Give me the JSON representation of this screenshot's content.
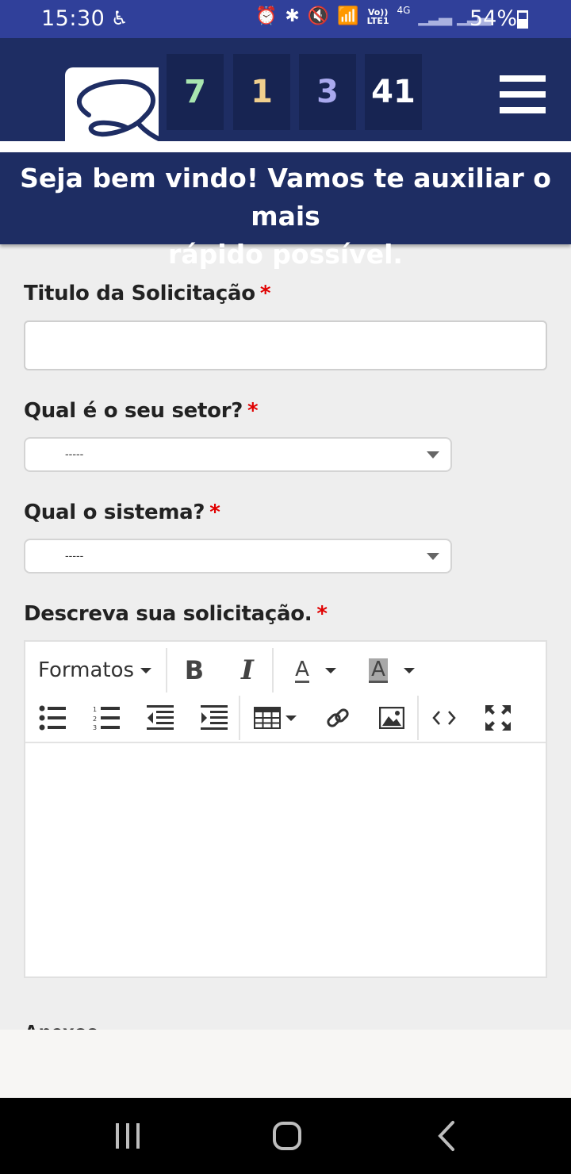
{
  "status_bar": {
    "time": "15:30",
    "battery": "54%",
    "battery_level": 0.54,
    "network_volte": "Vo))",
    "network_lte": "LTE1",
    "network_4g": "4G"
  },
  "header": {
    "counters": [
      {
        "value": "7",
        "color": "#a8e6b0"
      },
      {
        "value": "1",
        "color": "#f0cf8e"
      },
      {
        "value": "3",
        "color": "#a9a9ee"
      },
      {
        "value": "41",
        "color": "#ffffff"
      }
    ]
  },
  "welcome": {
    "line1": "Seja bem vindo! Vamos te auxiliar o mais",
    "line2": "rápido possível."
  },
  "form": {
    "required_mark": "*",
    "title_label": "Titulo da Solicitação",
    "title_value": "",
    "sector_label": "Qual é o seu setor?",
    "sector_selected": "-----",
    "system_label": "Qual o sistema?",
    "system_selected": "-----",
    "description_label": "Descreva sua solicitação.",
    "next_label_partial": "Anexos"
  },
  "editor": {
    "formats_label": "Formatos",
    "bold_label": "B",
    "italic_label": "I",
    "text_color_label": "A",
    "bg_color_label": "A"
  },
  "colors": {
    "status_bar": "#30409a",
    "header": "#1e2d63",
    "required": "#e00000"
  }
}
